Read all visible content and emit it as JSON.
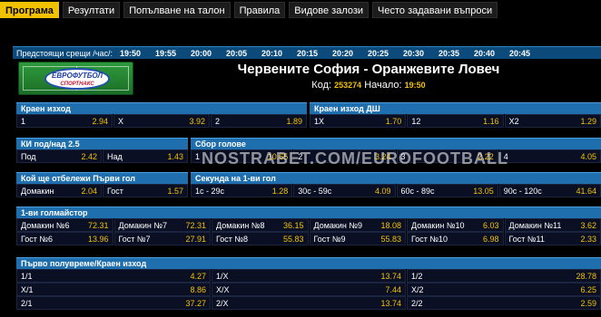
{
  "nav": [
    "Програма",
    "Резултати",
    "Попълване на талон",
    "Правила",
    "Видове залози",
    "Често задавани въпроси"
  ],
  "upcoming": {
    "label": "Предстоящи срещи /час/:",
    "times": [
      "19:50",
      "19:55",
      "20:00",
      "20:05",
      "20:10",
      "20:15",
      "20:20",
      "20:25",
      "20:30",
      "20:35",
      "20:40",
      "20:45"
    ]
  },
  "logo": {
    "line1": "ЕВРОФУТБОЛ",
    "line2": "СПОРТНАКС"
  },
  "match": {
    "title": "Червените София - Оранжевите Ловеч",
    "code_label": "Код:",
    "code": "253274",
    "start_label": "Начало:",
    "start": "19:50"
  },
  "markets": {
    "final": {
      "title": "Краен изход",
      "cells": [
        {
          "k": "1",
          "v": "2.94"
        },
        {
          "k": "X",
          "v": "3.92"
        },
        {
          "k": "2",
          "v": "1.89"
        }
      ]
    },
    "final_dc": {
      "title": "Краен изход ДШ",
      "cells": [
        {
          "k": "1X",
          "v": "1.70"
        },
        {
          "k": "12",
          "v": "1.16"
        },
        {
          "k": "X2",
          "v": "1.29"
        }
      ]
    },
    "ki_ou": {
      "title": "КИ под/над 2.5",
      "cells": [
        {
          "k": "Под",
          "v": "2.42"
        },
        {
          "k": "Над",
          "v": "1.43"
        }
      ]
    },
    "total_goals": {
      "title": "Сбор голове",
      "cells": [
        {
          "k": "1",
          "v": "10.65"
        },
        {
          "k": "2",
          "v": "3.24"
        },
        {
          "k": "3",
          "v": "2.22"
        },
        {
          "k": "4",
          "v": "4.05"
        }
      ]
    },
    "first_goal": {
      "title": "Кой ще отбележи Първи гол",
      "cells": [
        {
          "k": "Домакин",
          "v": "2.04"
        },
        {
          "k": "Гост",
          "v": "1.57"
        }
      ]
    },
    "first_goal_time": {
      "title": "Секунда на 1-ви гол",
      "cells": [
        {
          "k": "1c - 29c",
          "v": "1.28"
        },
        {
          "k": "30c - 59c",
          "v": "4.09"
        },
        {
          "k": "60c - 89c",
          "v": "13.05"
        },
        {
          "k": "90c - 120c",
          "v": "41.64"
        }
      ]
    },
    "first_scorer": {
      "title": "1-ви голмайстор",
      "rows": [
        [
          {
            "k": "Домакин №6",
            "v": "72.31"
          },
          {
            "k": "Домакин №7",
            "v": "72.31"
          },
          {
            "k": "Домакин №8",
            "v": "36.15"
          },
          {
            "k": "Домакин №9",
            "v": "18.08"
          },
          {
            "k": "Домакин №10",
            "v": "6.03"
          },
          {
            "k": "Домакин №11",
            "v": "3.62"
          }
        ],
        [
          {
            "k": "Гост №6",
            "v": "13.96"
          },
          {
            "k": "Гост №7",
            "v": "27.91"
          },
          {
            "k": "Гост №8",
            "v": "55.83"
          },
          {
            "k": "Гост №9",
            "v": "55.83"
          },
          {
            "k": "Гост №10",
            "v": "6.98"
          },
          {
            "k": "Гост №11",
            "v": "2.33"
          }
        ]
      ]
    },
    "ht_ft": {
      "title": "Първо полувреме/Краен изход",
      "rows": [
        [
          {
            "k": "1/1",
            "v": "4.27"
          },
          {
            "k": "1/X",
            "v": "13.74"
          },
          {
            "k": "1/2",
            "v": "28.78"
          }
        ],
        [
          {
            "k": "X/1",
            "v": "8.86"
          },
          {
            "k": "X/X",
            "v": "7.44"
          },
          {
            "k": "X/2",
            "v": "6.25"
          }
        ],
        [
          {
            "k": "2/1",
            "v": "37.27"
          },
          {
            "k": "2/X",
            "v": "13.74"
          },
          {
            "k": "2/2",
            "v": "2.59"
          }
        ]
      ]
    }
  },
  "watermark": "NOSTRABET.COM/EUROFOOTBALL"
}
